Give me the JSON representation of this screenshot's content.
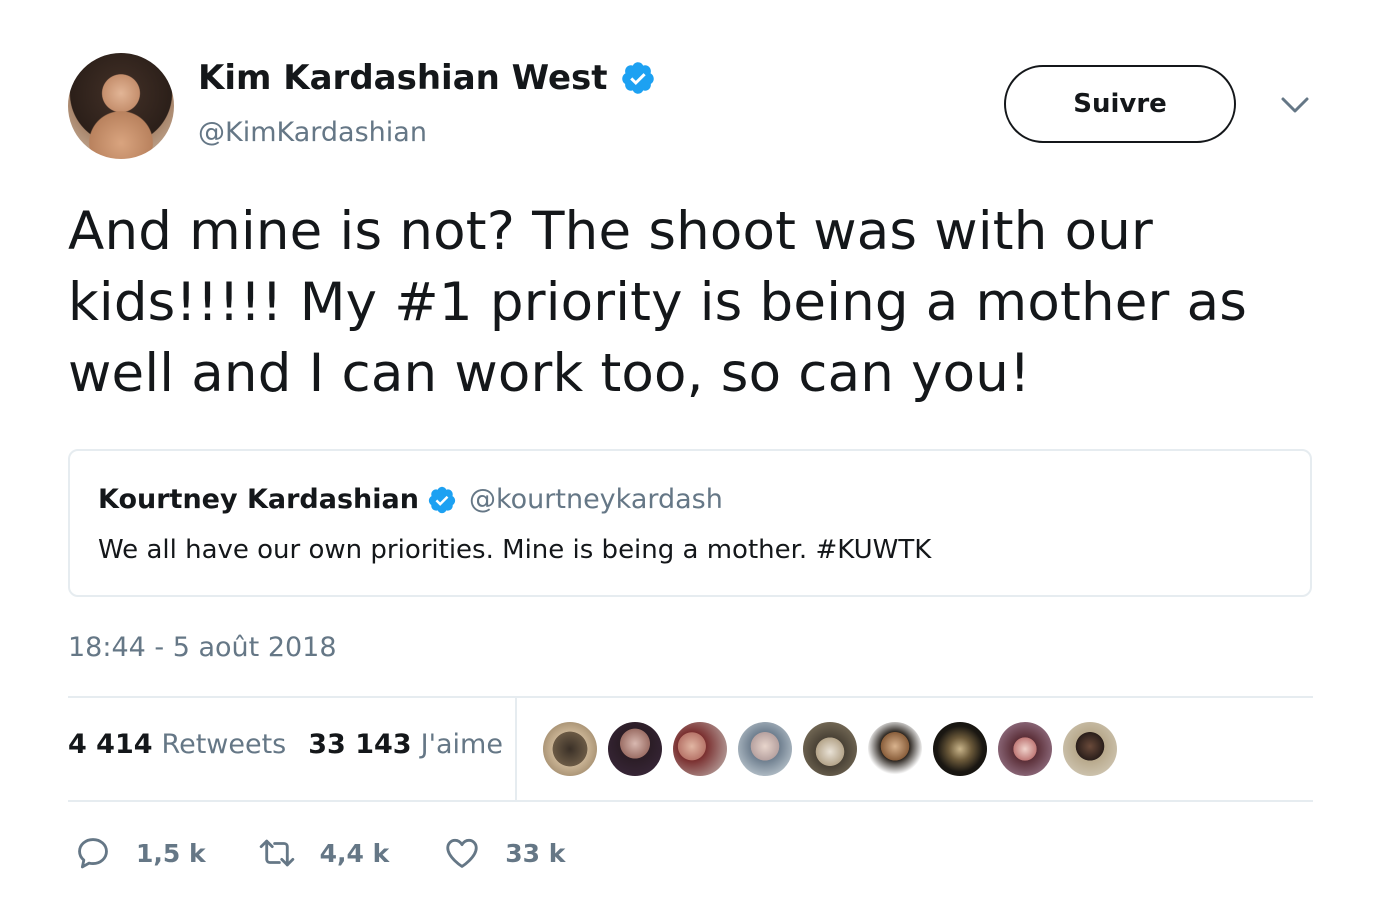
{
  "author": {
    "name": "Kim Kardashian West",
    "handle": "@KimKardashian",
    "verified_icon": "verified-badge-icon"
  },
  "follow_button": {
    "label": "Suivre"
  },
  "menu": {
    "icon": "chevron-down-icon"
  },
  "tweet": {
    "text": "And mine is not? The shoot was with our kids!!!!! My #1 priority is being a mother as well and I can work too, so can you!"
  },
  "quoted_tweet": {
    "name": "Kourtney Kardashian",
    "handle": "@kourtneykardash",
    "text": "We all have our own priorities. Mine is being a mother. #KUWTK"
  },
  "timestamp": "18:44 - 5 août 2018",
  "stats": {
    "retweets_count": "4 414",
    "retweets_label": "Retweets",
    "likes_count": "33 143",
    "likes_label": "J'aime"
  },
  "likers_avatars_count": 9,
  "actions": {
    "reply": {
      "icon": "reply-icon",
      "count": "1,5 k"
    },
    "retweet": {
      "icon": "retweet-icon",
      "count": "4,4 k"
    },
    "like": {
      "icon": "heart-icon",
      "count": "33 k"
    }
  },
  "colors": {
    "text": "#14171a",
    "secondary": "#657786",
    "verified": "#1da1f2",
    "border": "#e6ecf0"
  }
}
